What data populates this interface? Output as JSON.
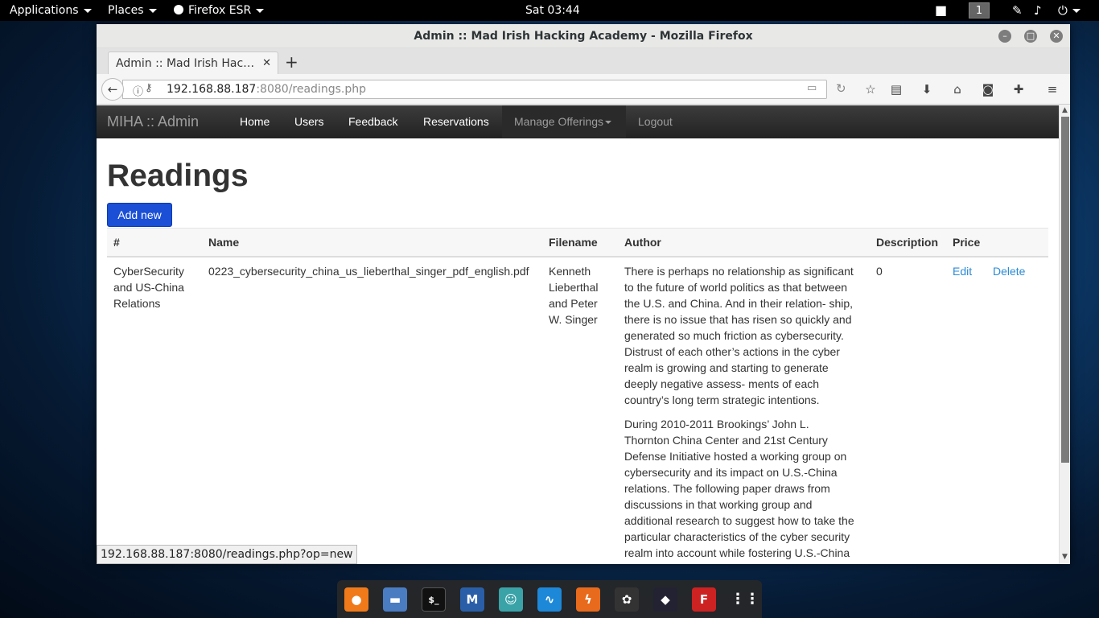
{
  "top_panel": {
    "applications": "Applications",
    "places": "Places",
    "browser": "Firefox ESR",
    "clock": "Sat 03:44",
    "workspace": "1"
  },
  "window": {
    "title": "Admin :: Mad Irish Hacking Academy - Mozilla Firefox",
    "tab_title": "Admin :: Mad Irish Hacking Academy",
    "url_host": "192.168.88.187",
    "url_path": ":8080/readings.php"
  },
  "site": {
    "brand": "MIHA :: Admin",
    "nav": {
      "home": "Home",
      "users": "Users",
      "feedback": "Feedback",
      "reservations": "Reservations",
      "manage": "Manage Offerings",
      "logout": "Logout"
    },
    "heading": "Readings",
    "add_new": "Add new",
    "columns": {
      "num": "#",
      "name": "Name",
      "filename": "Filename",
      "author": "Author",
      "description": "Description",
      "price": "Price"
    },
    "row": {
      "num_l1": "CyberSecurity",
      "num_l2": "and US-China",
      "num_l3": "Relations",
      "name": "0223_cybersecurity_china_us_lieberthal_singer_pdf_english.pdf",
      "file_l1": "Kenneth",
      "file_l2": "Lieberthal",
      "file_l3": "and Peter",
      "file_l4": "W. Singer",
      "p1": [
        "There is perhaps no relationship as significant",
        "to the future of world politics as that between",
        "the U.S. and China. And in their relation- ship,",
        "there is no issue that has risen so quickly and",
        "generated so much friction as cybersecurity.",
        "Distrust of each other’s actions in the cyber",
        "realm is growing and starting to generate",
        "deeply negative assess- ments of each",
        "country’s long term strategic intentions."
      ],
      "p2": [
        "During 2010-2011 Brookings’ John L.",
        "Thornton China Center and 21st Century",
        "Defense Initiative hosted a working group on",
        "cybersecurity and its impact on U.S.-China",
        "relations. The following paper draws from",
        "discussions in that working group and",
        "additional research to suggest how to take the",
        "particular characteristics of the cyber security",
        "realm into account while fostering U.S.-China"
      ],
      "description": "0",
      "edit": "Edit",
      "delete": "Delete"
    }
  },
  "status_url": "192.168.88.187:8080/readings.php?op=new"
}
